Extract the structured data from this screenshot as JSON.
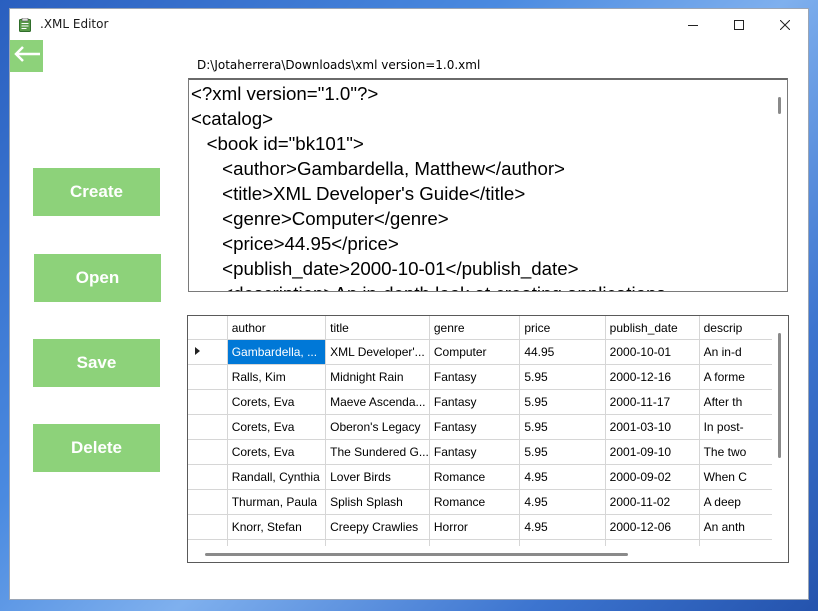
{
  "window": {
    "title": ".XML Editor"
  },
  "sidebar": {
    "buttons": [
      {
        "label": "Create"
      },
      {
        "label": "Open"
      },
      {
        "label": "Save"
      },
      {
        "label": "Delete"
      }
    ]
  },
  "file": {
    "path": "D:\\Jotaherrera\\Downloads\\xml version=1.0.xml"
  },
  "editor": {
    "content": "<?xml version=\"1.0\"?>\n<catalog>\n   <book id=\"bk101\">\n      <author>Gambardella, Matthew</author>\n      <title>XML Developer's Guide</title>\n      <genre>Computer</genre>\n      <price>44.95</price>\n      <publish_date>2000-10-01</publish_date>\n      <description>An in-depth look at creating applications"
  },
  "grid": {
    "columns": [
      "author",
      "title",
      "genre",
      "price",
      "publish_date",
      "descrip"
    ],
    "rows": [
      {
        "author": "Gambardella, ...",
        "title": "XML Developer'...",
        "genre": "Computer",
        "price": "44.95",
        "publish_date": "2000-10-01",
        "description": "An in-d"
      },
      {
        "author": "Ralls, Kim",
        "title": "Midnight Rain",
        "genre": "Fantasy",
        "price": "5.95",
        "publish_date": "2000-12-16",
        "description": "A forme"
      },
      {
        "author": "Corets, Eva",
        "title": "Maeve Ascenda...",
        "genre": "Fantasy",
        "price": "5.95",
        "publish_date": "2000-11-17",
        "description": "After th"
      },
      {
        "author": "Corets, Eva",
        "title": "Oberon's Legacy",
        "genre": "Fantasy",
        "price": "5.95",
        "publish_date": "2001-03-10",
        "description": "In post-"
      },
      {
        "author": "Corets, Eva",
        "title": "The Sundered G...",
        "genre": "Fantasy",
        "price": "5.95",
        "publish_date": "2001-09-10",
        "description": "The two"
      },
      {
        "author": "Randall, Cynthia",
        "title": "Lover Birds",
        "genre": "Romance",
        "price": "4.95",
        "publish_date": "2000-09-02",
        "description": "When C"
      },
      {
        "author": "Thurman, Paula",
        "title": "Splish Splash",
        "genre": "Romance",
        "price": "4.95",
        "publish_date": "2000-11-02",
        "description": "A deep"
      },
      {
        "author": "Knorr, Stefan",
        "title": "Creepy Crawlies",
        "genre": "Horror",
        "price": "4.95",
        "publish_date": "2000-12-06",
        "description": "An anth"
      },
      {
        "author": "",
        "title": "",
        "genre": "",
        "price": "",
        "publish_date": "",
        "description": ""
      }
    ]
  },
  "colors": {
    "accent_green": "#8dd27a",
    "selection": "#0078d7"
  },
  "icons": {
    "back": "arrow-left-icon",
    "app": "clipboard-icon"
  }
}
